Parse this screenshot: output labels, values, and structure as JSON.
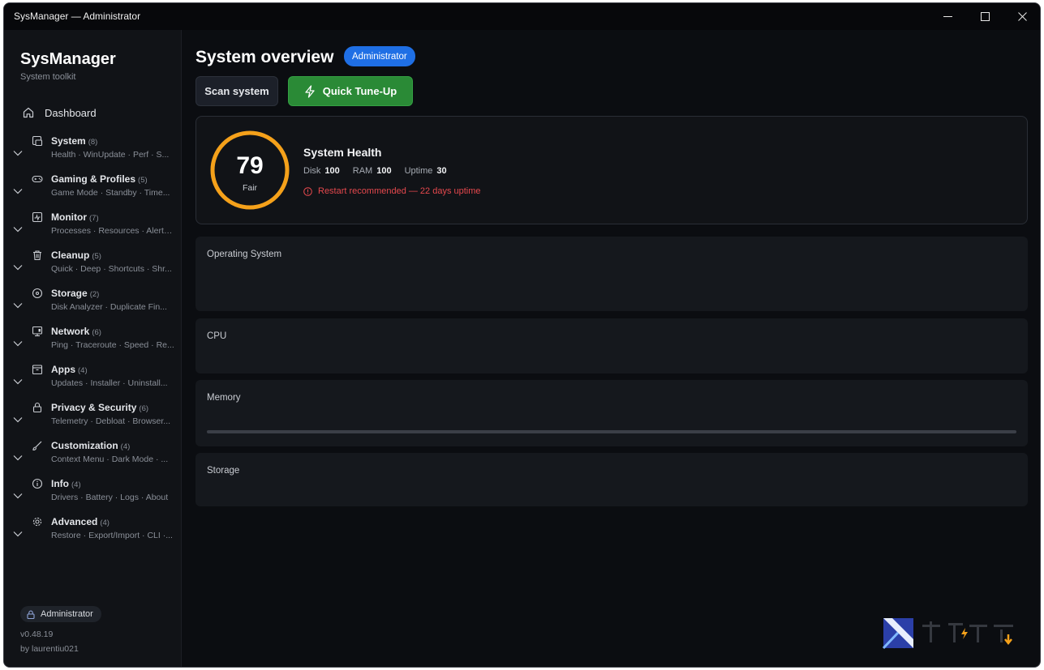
{
  "window": {
    "title": "SysManager — Administrator"
  },
  "brand": {
    "name": "SysManager",
    "subtitle": "System toolkit"
  },
  "sidebar": {
    "dashboard_label": "Dashboard",
    "groups": [
      {
        "name": "System",
        "count": "(8)",
        "sub": "Health · WinUpdate · Perf · S...",
        "icon": "system-icon"
      },
      {
        "name": "Gaming & Profiles",
        "count": "(5)",
        "sub": "Game Mode · Standby · Time...",
        "icon": "gamepad-icon"
      },
      {
        "name": "Monitor",
        "count": "(7)",
        "sub": "Processes · Resources · Alerts...",
        "icon": "monitor-icon"
      },
      {
        "name": "Cleanup",
        "count": "(5)",
        "sub": "Quick · Deep · Shortcuts · Shr...",
        "icon": "trash-icon"
      },
      {
        "name": "Storage",
        "count": "(2)",
        "sub": "Disk Analyzer · Duplicate Fin...",
        "icon": "disk-icon"
      },
      {
        "name": "Network",
        "count": "(6)",
        "sub": "Ping · Traceroute · Speed · Re...",
        "icon": "network-icon"
      },
      {
        "name": "Apps",
        "count": "(4)",
        "sub": "Updates · Installer · Uninstall...",
        "icon": "apps-icon"
      },
      {
        "name": "Privacy & Security",
        "count": "(6)",
        "sub": "Telemetry · Debloat · Browser...",
        "icon": "lock-icon"
      },
      {
        "name": "Customization",
        "count": "(4)",
        "sub": "Context Menu · Dark Mode · ...",
        "icon": "brush-icon"
      },
      {
        "name": "Info",
        "count": "(4)",
        "sub": "Drivers · Battery · Logs · About",
        "icon": "info-icon"
      },
      {
        "name": "Advanced",
        "count": "(4)",
        "sub": "Restore · Export/Import · CLI ·...",
        "icon": "gear-icon"
      }
    ],
    "admin_label": "Administrator",
    "version": "v0.48.19",
    "author": "by laurentiu021"
  },
  "main": {
    "title": "System overview",
    "badge": "Administrator",
    "scan_label": "Scan system",
    "tune_label": "Quick Tune-Up",
    "health": {
      "score": "79",
      "score_fraction": 0.79,
      "rating": "Fair",
      "title": "System Health",
      "disk_label": "Disk",
      "disk_value": "100",
      "ram_label": "RAM",
      "ram_value": "100",
      "uptime_label": "Uptime",
      "uptime_value": "30",
      "warning": "Restart recommended — 22 days uptime"
    },
    "sections": {
      "os": "Operating System",
      "cpu": "CPU",
      "memory": "Memory",
      "memory_usage_fraction": 0,
      "storage": "Storage"
    }
  },
  "colors": {
    "accent_orange": "#f5a11a",
    "accent_blue": "#1f6fe5",
    "accent_green": "#2a8a36",
    "warning_red": "#e5484d"
  }
}
